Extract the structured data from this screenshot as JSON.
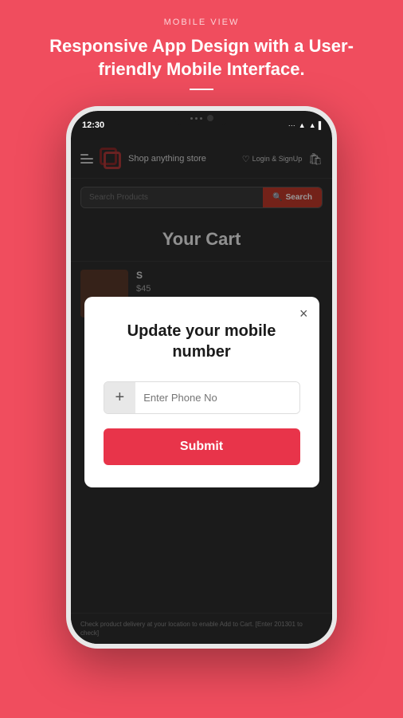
{
  "header": {
    "view_label": "MOBILE VIEW",
    "headline": "Responsive App Design with a User-friendly Mobile Interface."
  },
  "phone": {
    "status_time": "12:30",
    "status_icons": "··· ▲ ▲ ▐"
  },
  "navbar": {
    "store_name": "Shop anything store",
    "login_label": "Login & SignUp"
  },
  "search": {
    "placeholder": "Search Products",
    "button_label": "Search"
  },
  "page": {
    "title": "Your Cart"
  },
  "modal": {
    "title": "Update your mobile number",
    "phone_placeholder": "Enter Phone No",
    "prefix": "+",
    "submit_label": "Submit",
    "close_icon": "×"
  },
  "product": {
    "title": "S",
    "price": "$45",
    "delivery_note": "Check product delivery at your location to enable Add to Cart. [Enter 201301 to check]"
  }
}
